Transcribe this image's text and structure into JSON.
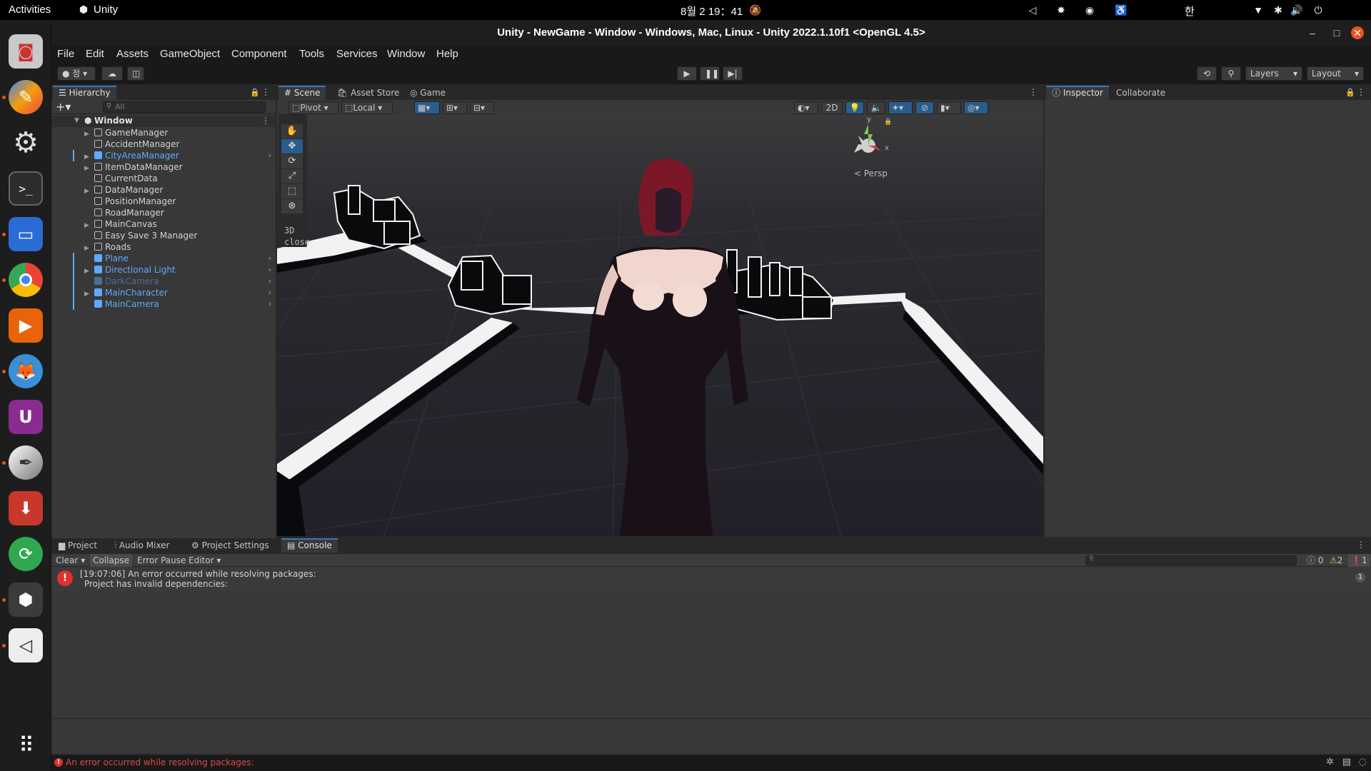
{
  "topbar": {
    "activities": "Activities",
    "app_name": "Unity",
    "clock": "8월 2  19：41",
    "ime": "한"
  },
  "window": {
    "title": "Unity - NewGame - Window - Windows, Mac, Linux - Unity 2022.1.10f1 <OpenGL 4.5>"
  },
  "menu": [
    "File",
    "Edit",
    "Assets",
    "GameObject",
    "Component",
    "Tools",
    "Services",
    "Window",
    "Help"
  ],
  "toolbar": {
    "account_label": "정",
    "layers_label": "Layers",
    "layout_label": "Layout"
  },
  "hierarchy": {
    "tab_label": "Hierarchy",
    "search_placeholder": "All",
    "scene_name": "Window",
    "items": [
      {
        "label": "GameManager",
        "expandable": true,
        "style": "normal"
      },
      {
        "label": "AccidentManager",
        "expandable": false,
        "style": "normal"
      },
      {
        "label": "CityAreaManager",
        "expandable": true,
        "style": "prefab"
      },
      {
        "label": "ItemDataManager",
        "expandable": true,
        "style": "normal"
      },
      {
        "label": "CurrentData",
        "expandable": false,
        "style": "normal"
      },
      {
        "label": "DataManager",
        "expandable": true,
        "style": "normal"
      },
      {
        "label": "PositionManager",
        "expandable": false,
        "style": "normal"
      },
      {
        "label": "RoadManager",
        "expandable": false,
        "style": "normal"
      },
      {
        "label": "MainCanvas",
        "expandable": true,
        "style": "normal"
      },
      {
        "label": "Easy Save 3 Manager",
        "expandable": false,
        "style": "normal"
      },
      {
        "label": "Roads",
        "expandable": true,
        "style": "normal"
      },
      {
        "label": "Plane",
        "expandable": false,
        "style": "prefab"
      },
      {
        "label": "Directional Light",
        "expandable": true,
        "style": "prefab"
      },
      {
        "label": "DarkCamera",
        "expandable": false,
        "style": "disabled"
      },
      {
        "label": "MainCharacter",
        "expandable": true,
        "style": "prefab"
      },
      {
        "label": "MainCamera",
        "expandable": false,
        "style": "prefab"
      }
    ]
  },
  "scene": {
    "tabs": [
      "Scene",
      "Asset Store",
      "Game"
    ],
    "pivot_label": "Pivot",
    "local_label": "Local",
    "mode_2d": "2D",
    "persp_label": "Persp",
    "axis_y": "y",
    "axis_x": "x",
    "overlay_3d": "3D",
    "overlay_close": "close"
  },
  "inspector": {
    "tabs": [
      "Inspector",
      "Collaborate"
    ]
  },
  "bottom": {
    "tabs": [
      "Project",
      "Audio Mixer",
      "Project Settings",
      "Console"
    ],
    "clear_label": "Clear",
    "collapse_label": "Collapse",
    "error_pause_label": "Error Pause",
    "editor_label": "Editor",
    "count_info": "0",
    "count_warn": "2",
    "count_error": "1",
    "log_line1": "[19:07:06] An error occurred while resolving packages:",
    "log_line2": "Project has invalid dependencies:",
    "log_count": "1"
  },
  "statusbar": {
    "message": "An error occurred while resolving packages:"
  }
}
